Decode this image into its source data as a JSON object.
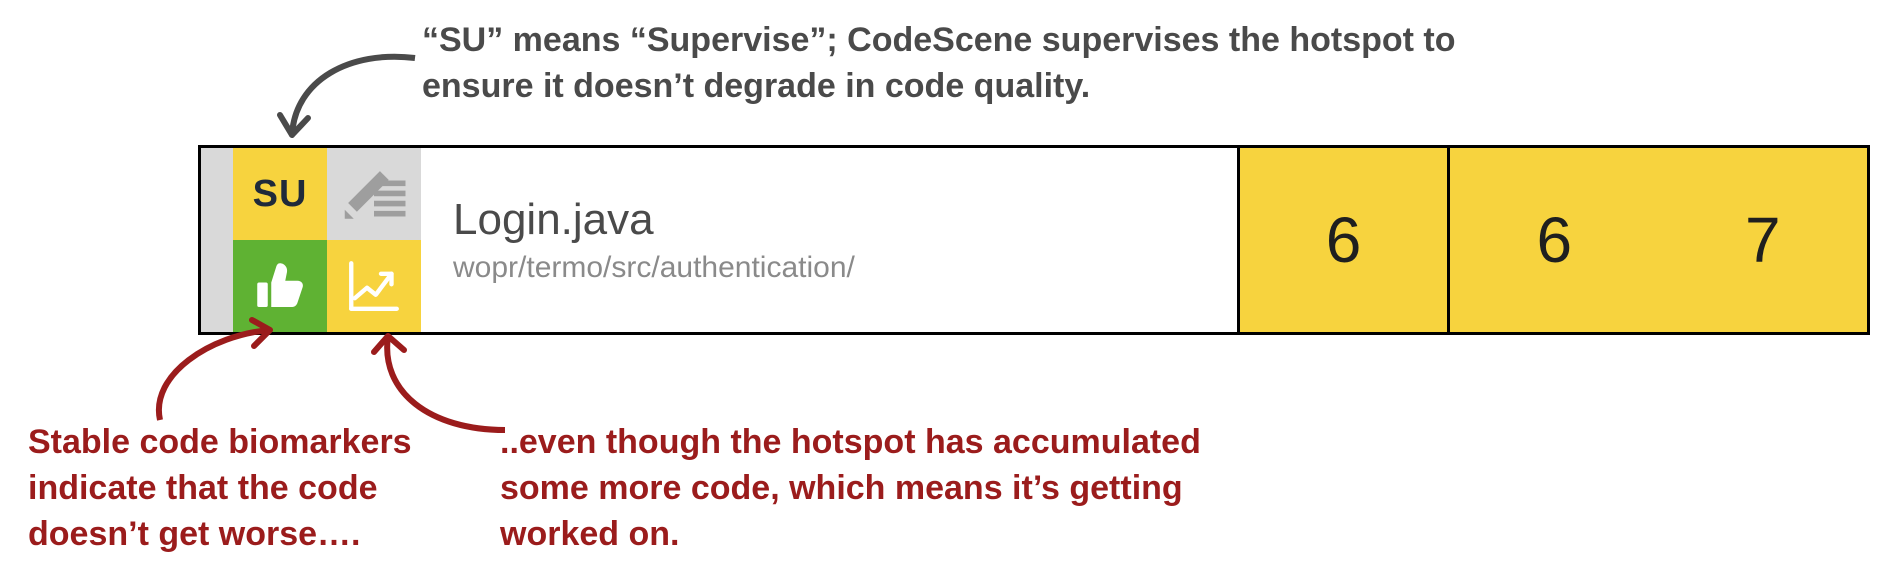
{
  "annotations": {
    "top": "“SU” means “Supervise”; CodeScene supervises the hotspot to ensure it doesn’t degrade in code quality.",
    "bottom_left": "Stable code biomarkers indicate that the code doesn’t get worse….",
    "bottom_right": "..even though the hotspot has accumulated some more code, which means it’s getting worked on."
  },
  "row": {
    "su_label": "SU",
    "filename": "Login.java",
    "filepath": "wopr/termo/src/authentication/",
    "metrics": {
      "a": "6",
      "b": "6",
      "c": "7"
    }
  },
  "icons": {
    "edit": "edit-icon",
    "thumb": "thumbs-up-icon",
    "trend": "trend-up-icon"
  },
  "colors": {
    "yellow": "#f7d33e",
    "green": "#5fb233",
    "grey": "#d9d9d9",
    "annotation_dark": "#4a4a4a",
    "annotation_red": "#9b1c1c"
  }
}
